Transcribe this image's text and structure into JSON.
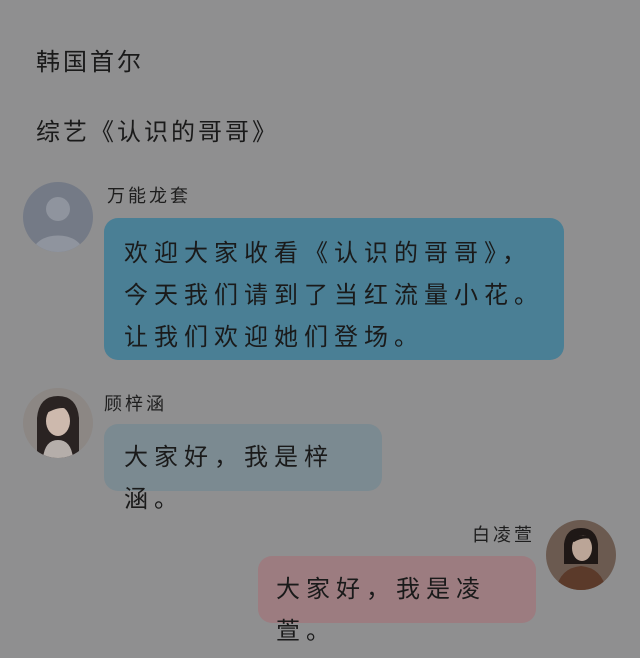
{
  "header": {
    "location": "韩国首尔",
    "show_title": "综艺《认识的哥哥》"
  },
  "messages": [
    {
      "sender": "万能龙套",
      "text": "欢迎大家收看《认识的哥哥》，今天我们请到了当红流量小花。让我们欢迎她们登场。",
      "side": "left",
      "bubble_color": "#4a7f95",
      "avatar": "default-user-avatar"
    },
    {
      "sender": "顾梓涵",
      "text": "大家好，我是梓涵。",
      "side": "left",
      "bubble_color": "#7b8a91",
      "avatar": "long-hair-girl-avatar"
    },
    {
      "sender": "白凌萱",
      "text": "大家好，我是凌萱。",
      "side": "right",
      "bubble_color": "#9c7c80",
      "avatar": "brown-coat-girl-avatar"
    }
  ]
}
